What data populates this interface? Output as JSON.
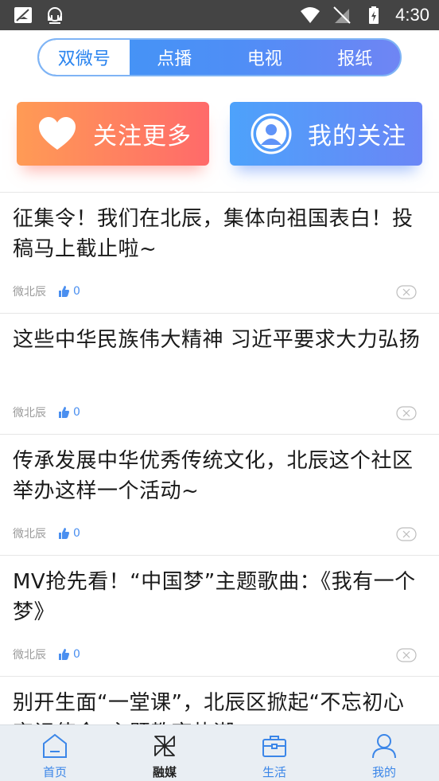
{
  "status_bar": {
    "time": "4:30"
  },
  "tabs": [
    {
      "label": "双微号",
      "active": true
    },
    {
      "label": "点播",
      "active": false
    },
    {
      "label": "电视",
      "active": false
    },
    {
      "label": "报纸",
      "active": false
    }
  ],
  "actions": {
    "follow_more": "关注更多",
    "my_follow": "我的关注"
  },
  "feed": [
    {
      "title": "征集令！我们在北辰，集体向祖国表白！投稿马上截止啦~",
      "source": "微北辰",
      "likes": "0"
    },
    {
      "title": "这些中华民族伟大精神 习近平要求大力弘扬",
      "source": "微北辰",
      "likes": "0"
    },
    {
      "title": "传承发展中华优秀传统文化，北辰这个社区举办这样一个活动~",
      "source": "微北辰",
      "likes": "0"
    },
    {
      "title": "MV抢先看！“中国梦”主题歌曲：《我有一个梦》",
      "source": "微北辰",
      "likes": "0"
    },
    {
      "title": "别开生面“一堂课”，北辰区掀起“不忘初心 牢记使命”主题教育热潮",
      "source": "",
      "likes": ""
    }
  ],
  "bottom_nav": [
    {
      "label": "首页",
      "icon": "home-icon"
    },
    {
      "label": "融媒",
      "icon": "pinwheel-icon",
      "active": true
    },
    {
      "label": "生活",
      "icon": "briefcase-icon"
    },
    {
      "label": "我的",
      "icon": "user-icon"
    }
  ],
  "colors": {
    "accent": "#3e97f6",
    "orange": "#ff8a5c",
    "nav_bg": "#e9eef3"
  }
}
